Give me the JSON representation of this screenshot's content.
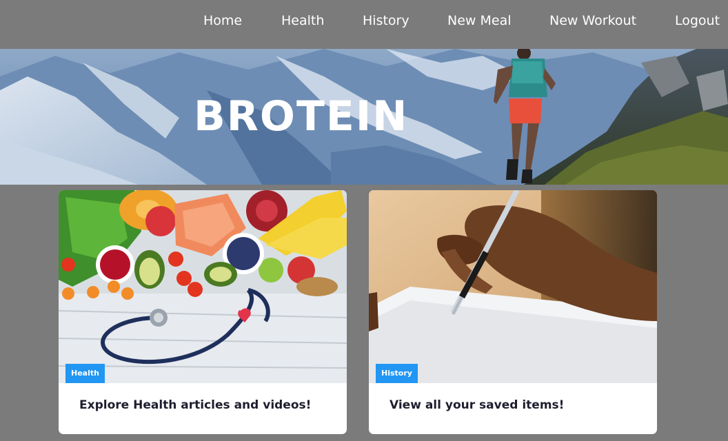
{
  "nav": {
    "items": [
      {
        "label": "Home"
      },
      {
        "label": "Health"
      },
      {
        "label": "History"
      },
      {
        "label": "New Meal"
      },
      {
        "label": "New Workout"
      },
      {
        "label": "Logout"
      }
    ]
  },
  "hero": {
    "title": "BROTEIN"
  },
  "cards": [
    {
      "badge": "Health",
      "text": "Explore Health articles and videos!"
    },
    {
      "badge": "History",
      "text": "View all your saved items!"
    }
  ],
  "colors": {
    "background": "#7b7b7b",
    "badge": "#2196f3",
    "card_text": "#1e1e2e"
  }
}
